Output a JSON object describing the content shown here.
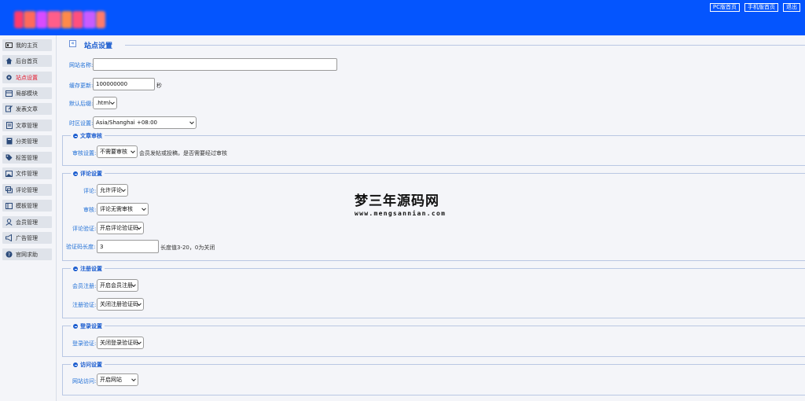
{
  "header": {
    "links": [
      "PC版首页",
      "手机版首页",
      "退出"
    ]
  },
  "sidebar": {
    "items": [
      {
        "label": "我的主页",
        "icon": "monitor-icon"
      },
      {
        "label": "后台首页",
        "icon": "home-icon"
      },
      {
        "label": "站点设置",
        "icon": "gear-icon",
        "active": true
      },
      {
        "label": "局部模块",
        "icon": "layout-icon"
      },
      {
        "label": "发表文章",
        "icon": "edit-icon"
      },
      {
        "label": "文章管理",
        "icon": "document-icon"
      },
      {
        "label": "分类管理",
        "icon": "folder-icon"
      },
      {
        "label": "标签管理",
        "icon": "tag-icon"
      },
      {
        "label": "文件管理",
        "icon": "image-icon"
      },
      {
        "label": "评论管理",
        "icon": "comment-icon"
      },
      {
        "label": "模板管理",
        "icon": "template-icon"
      },
      {
        "label": "会员管理",
        "icon": "user-icon"
      },
      {
        "label": "广告管理",
        "icon": "megaphone-icon"
      },
      {
        "label": "官网求助",
        "icon": "help-icon"
      }
    ]
  },
  "page": {
    "title": "站点设置",
    "collapse_symbol": "«"
  },
  "basic": {
    "site_name_label": "网站名称:",
    "site_name_value": "",
    "cache_label": "缓存更新:",
    "cache_value": "100000000",
    "cache_unit": "秒",
    "suffix_label": "默认后缀:",
    "suffix_value": ".html",
    "timezone_label": "时区设置:",
    "timezone_value": "Asia/Shanghai +08:00"
  },
  "article_review": {
    "legend": "文章审核",
    "review_label": "审核设置:",
    "review_value": "不需要审核",
    "review_note": "会员发帖或投稿，是否需要经过审核"
  },
  "comment_settings": {
    "legend": "评论设置",
    "comment_label": "评论:",
    "comment_value": "允许评论",
    "audit_label": "审核:",
    "audit_value": "评论无需审核",
    "captcha_label": "评论验证:",
    "captcha_value": "开启评论验证码",
    "length_label": "验证码长度:",
    "length_value": "3",
    "length_note": "长度值3-20，0为关闭"
  },
  "register_settings": {
    "legend": "注册设置",
    "member_label": "会员注册:",
    "member_value": "开启会员注册",
    "captcha_label": "注册验证:",
    "captcha_value": "关闭注册验证码"
  },
  "login_settings": {
    "legend": "登录设置",
    "captcha_label": "登录验证:",
    "captcha_value": "关闭登录验证码"
  },
  "access_settings": {
    "legend": "访问设置",
    "access_label": "网站访问:",
    "access_value": "开启网站"
  },
  "watermark": {
    "cn": "梦三年源码网",
    "en": "www.mengsannian.com"
  },
  "colors": {
    "header_bg": "#0455fe",
    "label_blue": "#1f6fd6",
    "active_red": "#e5182c"
  }
}
